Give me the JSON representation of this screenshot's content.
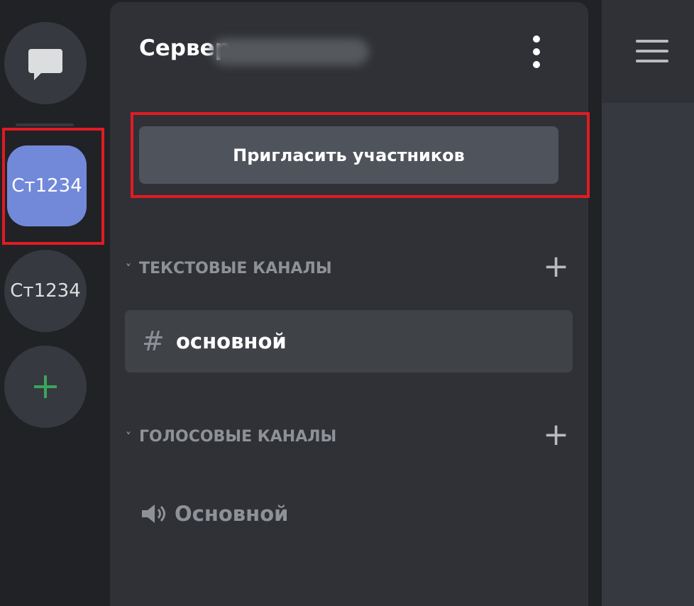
{
  "colors": {
    "background": "#202225",
    "panel": "#2f3136",
    "server_active": "#7289da",
    "invite_button": "#4f545c",
    "highlight": "#e01b24",
    "add_server": "#3ba55c"
  },
  "rail": {
    "dm_icon": "chat-bubble-icon",
    "servers": [
      {
        "label": "Ст1234",
        "active": true
      },
      {
        "label": "Ст1234",
        "active": false
      }
    ],
    "add_icon": "plus-icon",
    "add_label": "+"
  },
  "header": {
    "server_name": "Сервер",
    "menu_icon": "more-vertical-icon"
  },
  "invite": {
    "label": "Пригласить участников"
  },
  "categories": [
    {
      "label": "ТЕКСТОВЫЕ КАНАЛЫ",
      "chevron": "˅",
      "add_label": "+",
      "channels": [
        {
          "label": "основной",
          "icon": "#",
          "type": "text",
          "selected": true
        }
      ]
    },
    {
      "label": "ГОЛОСОВЫЕ КАНАЛЫ",
      "chevron": "˅",
      "add_label": "+",
      "channels": [
        {
          "label": "Основной",
          "icon": "speaker-icon",
          "type": "voice",
          "selected": false
        }
      ]
    }
  ],
  "right": {
    "menu_icon": "hamburger-menu-icon"
  }
}
